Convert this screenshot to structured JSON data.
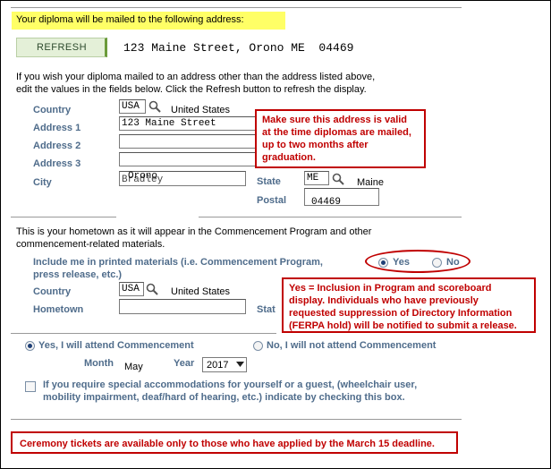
{
  "notice": {
    "mailed_address_heading": "Your diploma will be mailed to the following address:"
  },
  "refresh": {
    "label": "Refresh"
  },
  "current_address": "123 Maine Street, Orono ME  04469",
  "instructions": {
    "line1": "If you wish your diploma mailed to an address other than the address listed above,",
    "line2": "edit the values in the fields below. Click the Refresh button to refresh the display."
  },
  "mailing": {
    "country_label": "Country",
    "country_value": "USA",
    "country_name": "United States",
    "address1_label": "Address 1",
    "address1_value": "123 Maine Street",
    "address2_label": "Address 2",
    "address2_value": "",
    "address3_label": "Address 3",
    "address3_value": "",
    "city_label": "City",
    "city_value": "Orono",
    "city_ghost": "Bradley",
    "state_label": "State",
    "state_value": "ME",
    "state_name": "Maine",
    "postal_label": "Postal",
    "postal_value": "04469"
  },
  "callout_address": {
    "line1": "Make sure this address is valid",
    "line2": "at the time diplomas are mailed,",
    "line3": "up to two months after",
    "line4": "graduation."
  },
  "hometown": {
    "intro_line1": "This is your hometown as it will appear in the Commencement Program and other",
    "intro_line2": "commencement-related materials.",
    "include_line1": "Include me in printed materials (i.e. Commencement Program,",
    "include_line2": "press release, etc.)",
    "yes_label": "Yes",
    "no_label": "No",
    "country_label": "Country",
    "country_value": "USA",
    "country_name": "United States",
    "hometown_label": "Hometown",
    "hometown_value": "",
    "state_label_partial": "Stat"
  },
  "callout_yes": {
    "line1": "Yes = Inclusion in Program and scoreboard",
    "line2": "display.  Individuals who have previously",
    "line3": "requested suppression of Directory Information",
    "line4": "(FERPA hold) will be notified to submit a release."
  },
  "attendance": {
    "yes_label": "Yes, I will attend Commencement",
    "no_label": "No, I will not attend Commencement",
    "month_label": "Month",
    "month_value": "May",
    "year_label": "Year",
    "year_value": "2017"
  },
  "accommodations": {
    "line1": "If you require special accommodations for yourself or a guest, (wheelchair user,",
    "line2": "mobility impairment, deaf/hard of hearing, etc.) indicate by checking this box."
  },
  "callout_tickets": "Ceremony tickets are available only to those who have applied by the March 15 deadline.",
  "colors": {
    "highlight": "#ffff66",
    "callout": "#c00000",
    "label": "#4f6c8b",
    "button": "#e4f0d8"
  }
}
